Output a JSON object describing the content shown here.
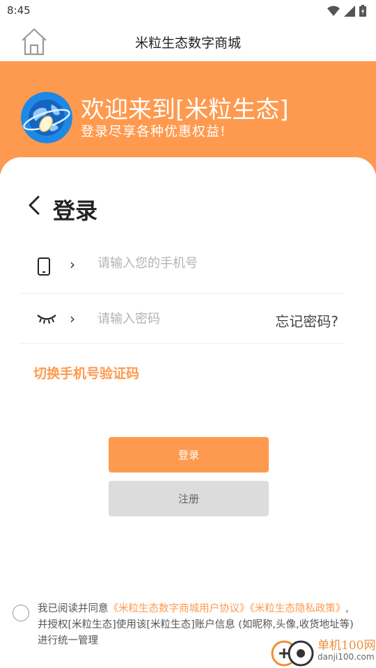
{
  "status_bar": {
    "time": "8:45"
  },
  "header": {
    "title": "米粒生态数字商城"
  },
  "banner": {
    "welcome": "欢迎来到[米粒生态]",
    "subtitle": "登录尽享各种优惠权益!"
  },
  "login": {
    "title": "登录",
    "phone_placeholder": "请输入您的手机号",
    "password_placeholder": "请输入密码",
    "forgot_label": "忘记密码?",
    "switch_label": "切换手机号验证码",
    "login_button": "登录",
    "register_button": "注册"
  },
  "agreement": {
    "prefix": "我已阅读并同意",
    "user_agreement": "《米粒生态数字商城用户协议》",
    "privacy_policy": "《米粒生态隐私政策》",
    "suffix": ",并授权[米粒生态]使用该[米粒生态]账户信息 (如昵称,头像,收货地址等)进行统一管理"
  },
  "watermark": {
    "name": "单机100网",
    "url": "danji100.com"
  },
  "colors": {
    "accent": "#fe9a4f",
    "register_bg": "#dcdcdc"
  },
  "icons": [
    "wifi-icon",
    "signal-icon",
    "battery-icon",
    "home-icon",
    "globe-logo-icon",
    "chevron-left-icon",
    "phone-icon",
    "eye-closed-icon",
    "chevron-right-icon",
    "radio-icon"
  ]
}
